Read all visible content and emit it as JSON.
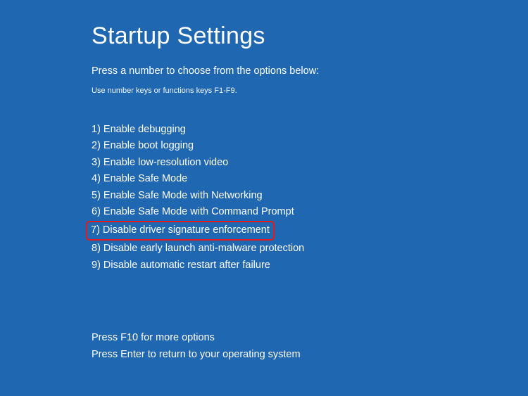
{
  "title": "Startup Settings",
  "subtitle": "Press a number to choose from the options below:",
  "hint": "Use number keys or functions keys F1-F9.",
  "options": [
    {
      "num": "1",
      "label": "Enable debugging",
      "highlighted": false
    },
    {
      "num": "2",
      "label": "Enable boot logging",
      "highlighted": false
    },
    {
      "num": "3",
      "label": "Enable low-resolution video",
      "highlighted": false
    },
    {
      "num": "4",
      "label": "Enable Safe Mode",
      "highlighted": false
    },
    {
      "num": "5",
      "label": "Enable Safe Mode with Networking",
      "highlighted": false
    },
    {
      "num": "6",
      "label": "Enable Safe Mode with Command Prompt",
      "highlighted": false
    },
    {
      "num": "7",
      "label": "Disable driver signature enforcement",
      "highlighted": true
    },
    {
      "num": "8",
      "label": "Disable early launch anti-malware protection",
      "highlighted": false
    },
    {
      "num": "9",
      "label": "Disable automatic restart after failure",
      "highlighted": false
    }
  ],
  "footer": {
    "more_options": "Press F10 for more options",
    "return_line": "Press Enter to return to your operating system"
  }
}
